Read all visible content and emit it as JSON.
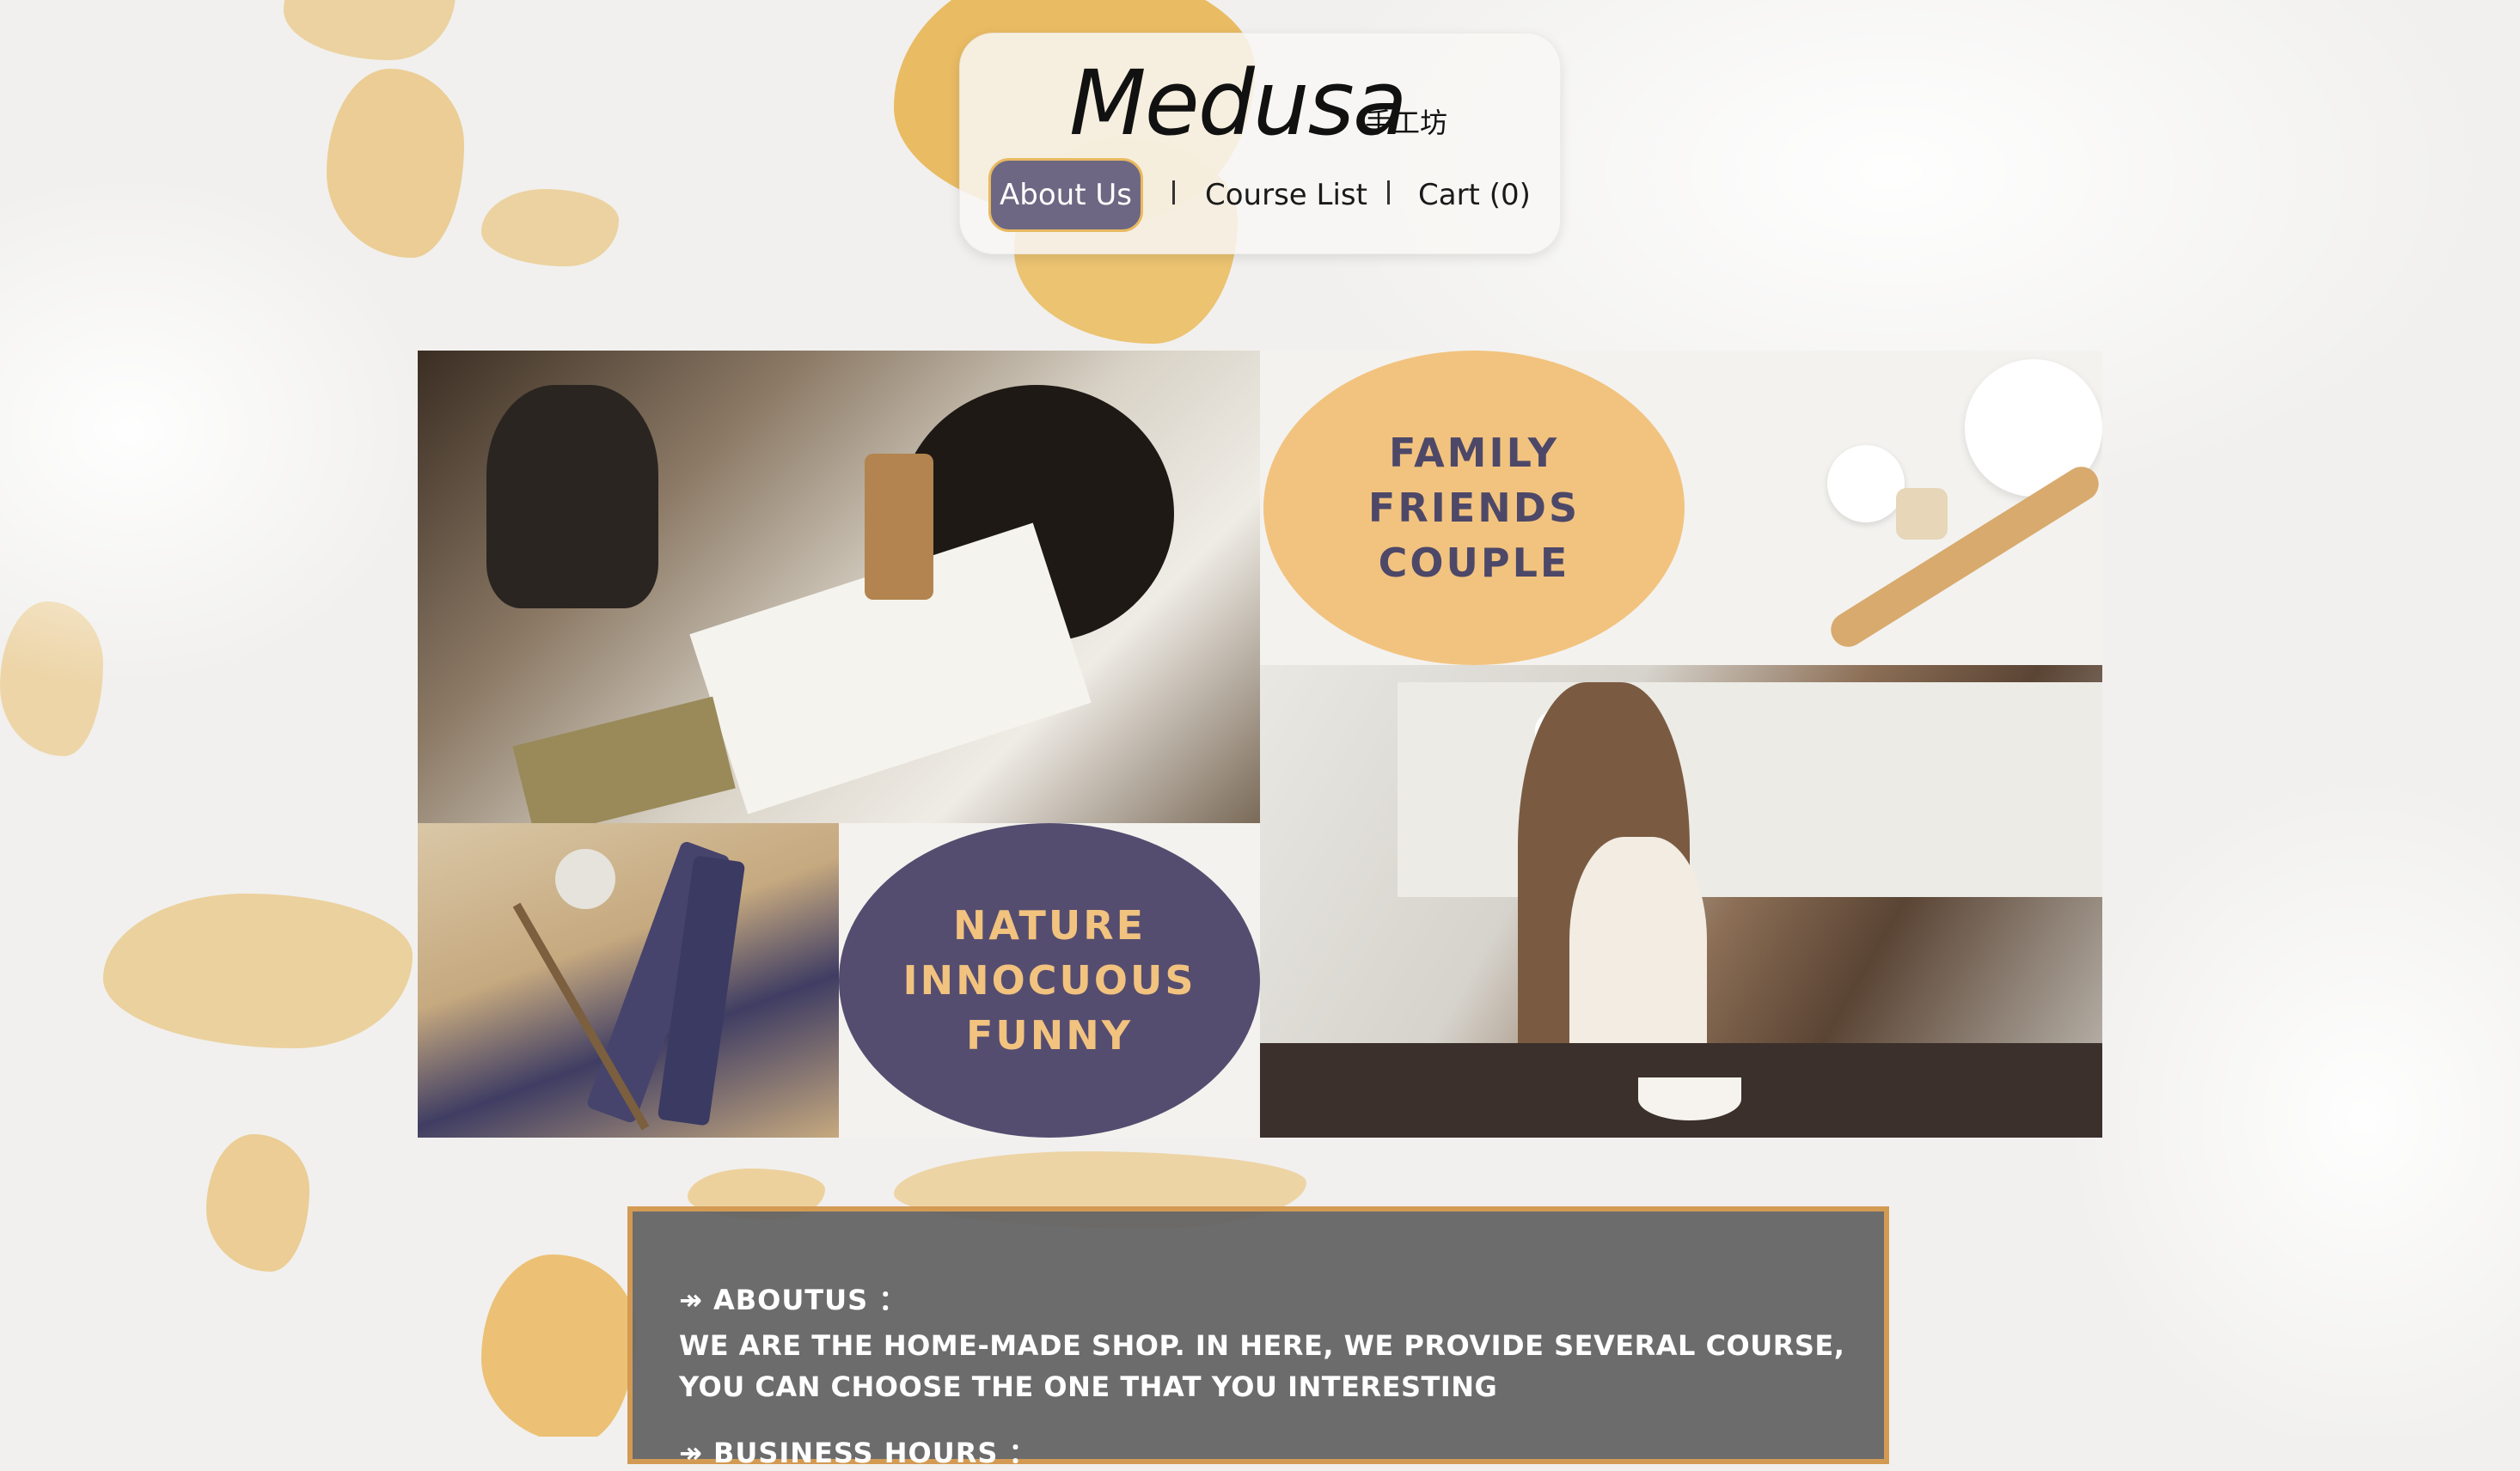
{
  "header": {
    "logo_main": "Medusa",
    "logo_sub": "手工坊",
    "nav": [
      {
        "label": "About Us",
        "active": true
      },
      {
        "label": "Course List",
        "active": false
      },
      {
        "label": "Cart (0)",
        "active": false
      }
    ]
  },
  "collage": {
    "blob_peach_lines": [
      "Family",
      "Friends",
      "Couple"
    ],
    "blob_purple_lines": [
      "Nature",
      "Innocuous",
      "Funny"
    ]
  },
  "about": {
    "heading": "↠ ABOUTUS ：",
    "text": "WE ARE THE HOME-MADE SHOP. IN HERE, WE PROVIDE SEVERAL COURSE, YOU CAN CHOOSE THE ONE THAT YOU INTERESTING",
    "hours_heading": "↠ BUSINESS HOURS ："
  },
  "colors": {
    "accent_purple": "#554d70",
    "accent_peach": "#f2c37f",
    "gold": "#e4b04a",
    "about_bg": "#646464",
    "about_border": "#d39a53"
  }
}
